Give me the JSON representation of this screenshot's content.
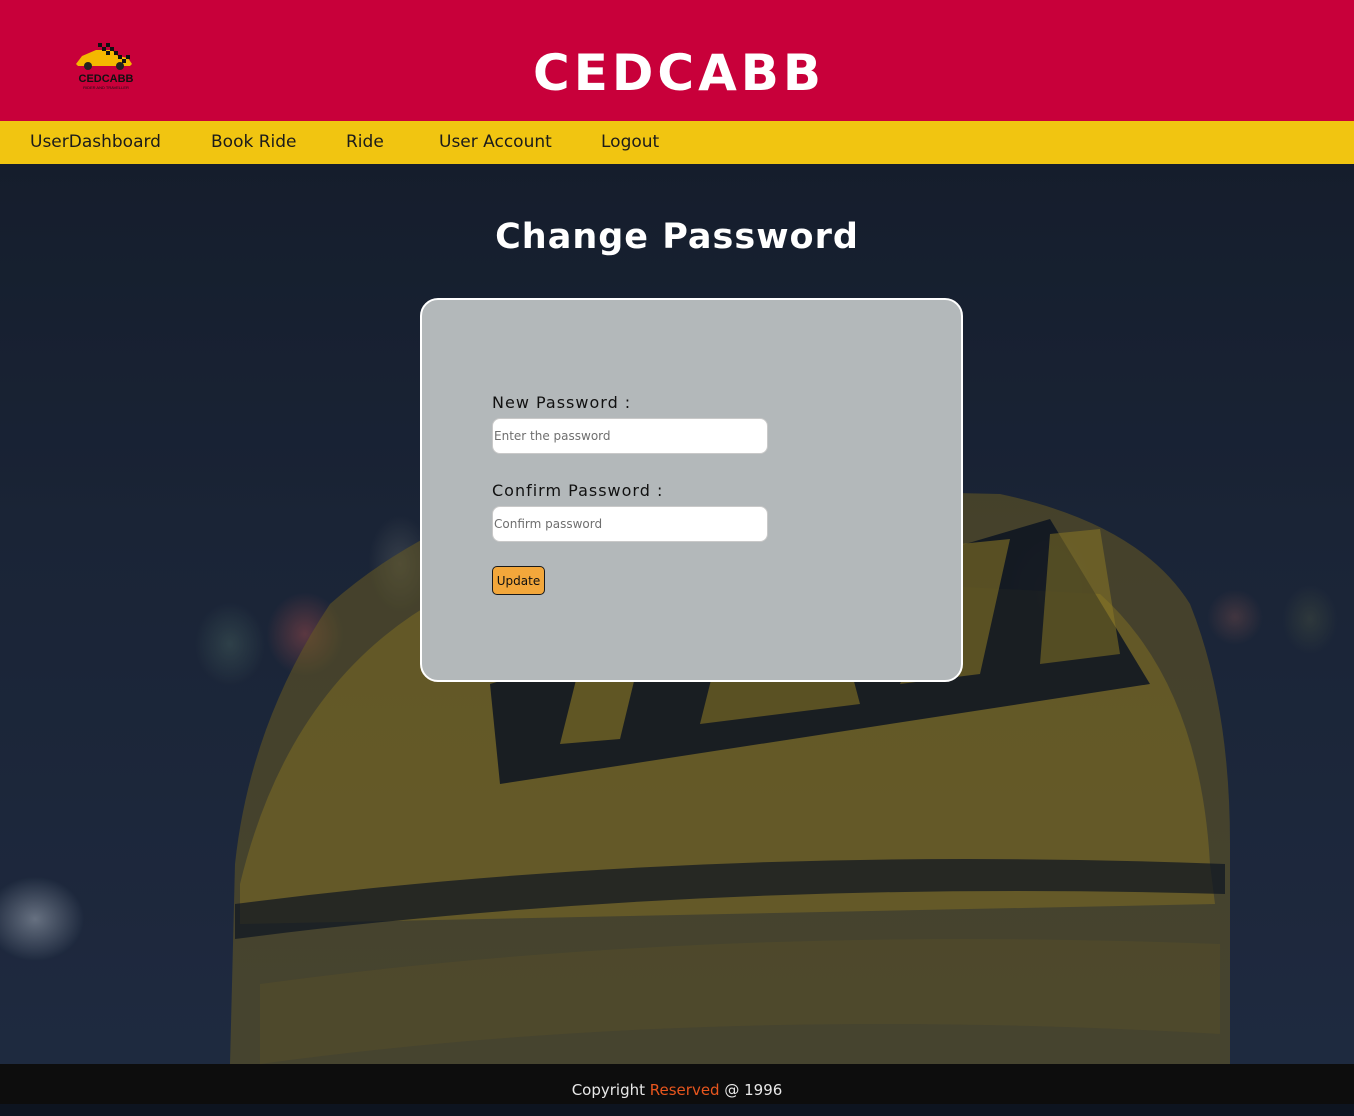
{
  "header": {
    "logo": {
      "text": "CEDCABB",
      "tagline": "RIDER AND TRAVELLER"
    },
    "title": "CEDCABB"
  },
  "nav": {
    "items": [
      {
        "label": "UserDashboard"
      },
      {
        "label": "Book Ride"
      },
      {
        "label": "Ride"
      },
      {
        "label": "User Account"
      },
      {
        "label": "Logout"
      }
    ]
  },
  "main": {
    "title": "Change Password",
    "form": {
      "new_password_label": "New Password :",
      "new_password_placeholder": "Enter the password",
      "new_password_value": "",
      "confirm_password_label": "Confirm Password :",
      "confirm_password_placeholder": "Confirm password",
      "confirm_password_value": "",
      "update_label": "Update"
    }
  },
  "footer": {
    "prefix": "Copyright ",
    "highlight": "Reserved",
    "suffix": " @ 1996"
  },
  "colors": {
    "header_bg": "#c8003a",
    "nav_bg": "#f1c511",
    "card_bg": "#b3b8ba",
    "button_bg": "#f3a73b",
    "footer_bg": "#0d0d0d",
    "footer_accent": "#e8561e"
  },
  "icons": {
    "logo": "taxi-logo-icon",
    "background": "taxi-sign-photo"
  }
}
